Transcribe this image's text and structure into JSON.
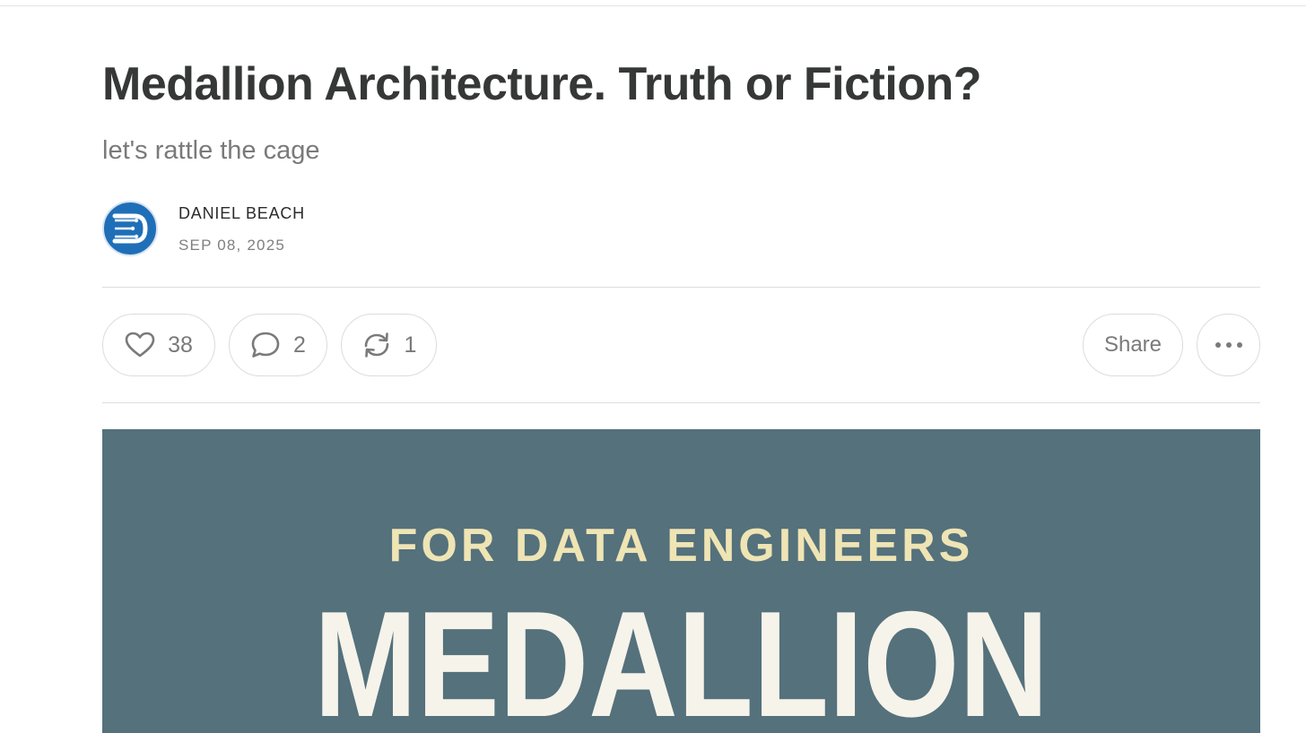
{
  "post": {
    "title": "Medallion Architecture. Truth or Fiction?",
    "subtitle": "let's rattle the cage",
    "author": "DANIEL BEACH",
    "date": "SEP 08, 2025"
  },
  "actions": {
    "like_count": "38",
    "comment_count": "2",
    "restack_count": "1",
    "share_label": "Share"
  },
  "icons": {
    "like": "heart-icon",
    "comment": "comment-bubble-icon",
    "restack": "restack-arrows-icon",
    "more": "ellipsis-icon"
  },
  "hero": {
    "kicker": "FOR DATA ENGINEERS",
    "title": "MEDALLION"
  },
  "colors": {
    "hero_background": "#54717c",
    "hero_kicker": "#efe4b4",
    "hero_title": "#f6f3ea",
    "avatar": "#1f6fb8"
  }
}
